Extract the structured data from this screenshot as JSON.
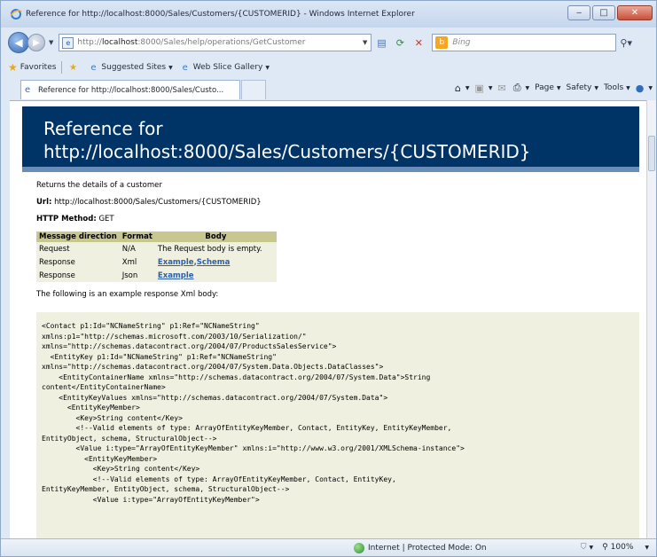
{
  "window": {
    "title": "Reference for http://localhost:8000/Sales/Customers/{CUSTOMERID} - Windows Internet Explorer"
  },
  "address": {
    "url_prefix": "http://",
    "url_host": "localhost",
    "url_rest": ":8000/Sales/help/operations/GetCustomer",
    "search_placeholder": "Bing"
  },
  "favorites": {
    "label": "Favorites",
    "items": [
      "Suggested Sites",
      "Web Slice Gallery"
    ]
  },
  "tab": {
    "label": "Reference for http://localhost:8000/Sales/Custo..."
  },
  "commands": [
    "Page",
    "Safety",
    "Tools"
  ],
  "page": {
    "heading": "Reference for http://localhost:8000/Sales/Customers/{CUSTOMERID}",
    "description": "Returns the details of a customer",
    "url_label": "Url:",
    "url_value": "http://localhost:8000/Sales/Customers/{CUSTOMERID}",
    "method_label": "HTTP Method:",
    "method_value": "GET",
    "table": {
      "headers": [
        "Message direction",
        "Format",
        "Body"
      ],
      "rows": [
        {
          "direction": "Request",
          "format": "N/A",
          "body": "The Request body is empty."
        },
        {
          "direction": "Response",
          "format": "Xml",
          "body_link1": "Example",
          "body_sep": ",",
          "body_link2": "Schema"
        },
        {
          "direction": "Response",
          "format": "Json",
          "body_link1": "Example"
        }
      ]
    },
    "example_intro": "The following is an example response Xml body:",
    "xml": "<Contact p1:Id=\"NCNameString\" p1:Ref=\"NCNameString\"\nxmlns:p1=\"http://schemas.microsoft.com/2003/10/Serialization/\"\nxmlns=\"http://schemas.datacontract.org/2004/07/ProductsSalesService\">\n  <EntityKey p1:Id=\"NCNameString\" p1:Ref=\"NCNameString\"\nxmlns=\"http://schemas.datacontract.org/2004/07/System.Data.Objects.DataClasses\">\n    <EntityContainerName xmlns=\"http://schemas.datacontract.org/2004/07/System.Data\">String\ncontent</EntityContainerName>\n    <EntityKeyValues xmlns=\"http://schemas.datacontract.org/2004/07/System.Data\">\n      <EntityKeyMember>\n        <Key>String content</Key>\n        <!--Valid elements of type: ArrayOfEntityKeyMember, Contact, EntityKey, EntityKeyMember,\nEntityObject, schema, StructuralObject-->\n        <Value i:type=\"ArrayOfEntityKeyMember\" xmlns:i=\"http://www.w3.org/2001/XMLSchema-instance\">\n          <EntityKeyMember>\n            <Key>String content</Key>\n            <!--Valid elements of type: ArrayOfEntityKeyMember, Contact, EntityKey,\nEntityKeyMember, EntityObject, schema, StructuralObject-->\n            <Value i:type=\"ArrayOfEntityKeyMember\">"
  },
  "status": {
    "zone": "Internet | Protected Mode: On",
    "zoom": "100%"
  }
}
